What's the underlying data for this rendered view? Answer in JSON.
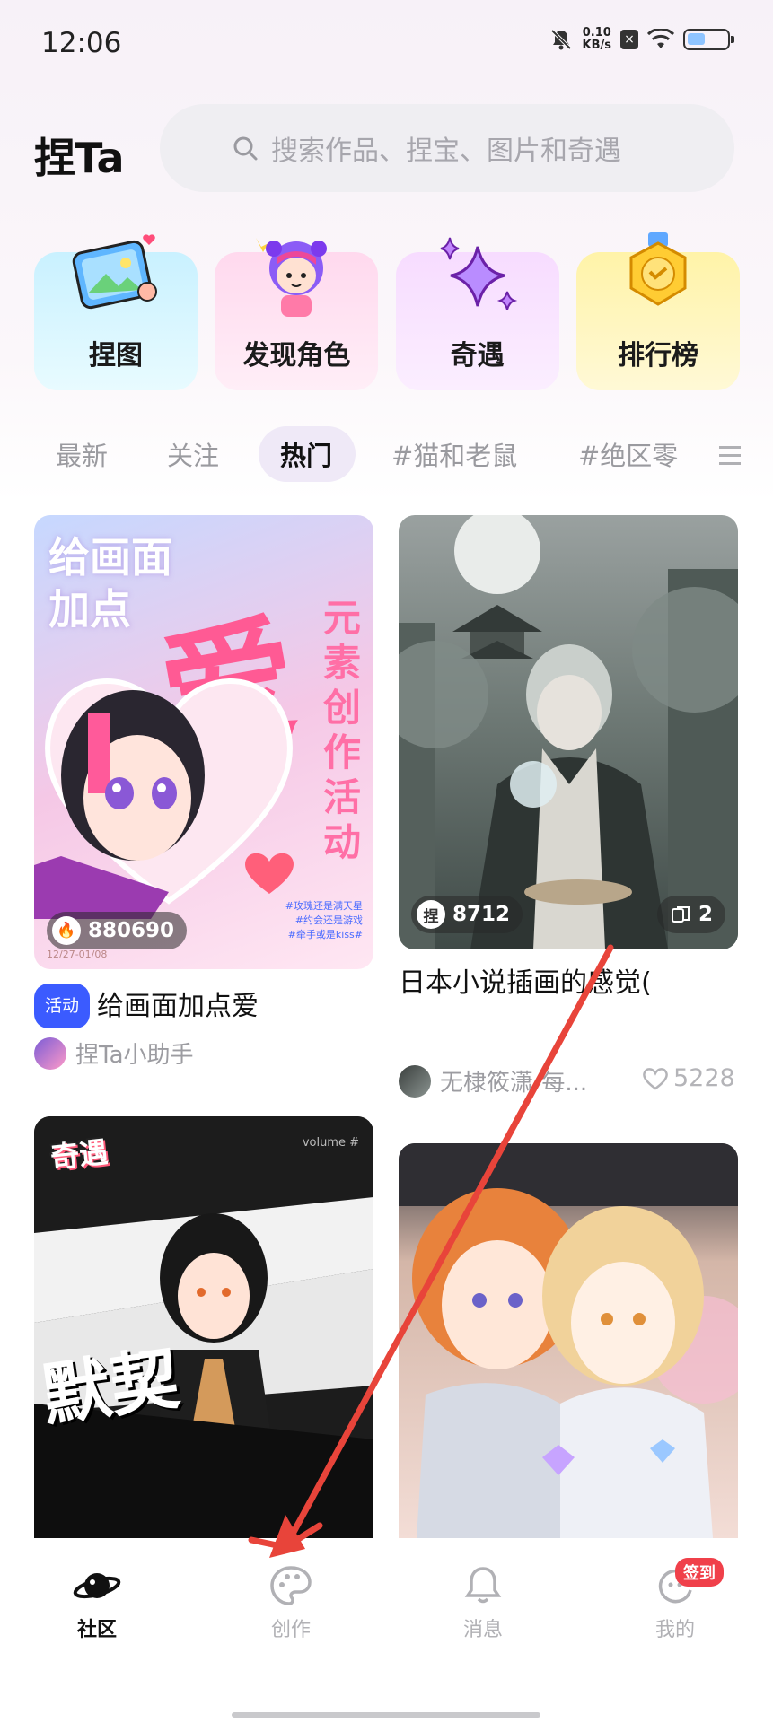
{
  "status": {
    "time": "12:06",
    "net_speed_value": "0.10",
    "net_speed_unit": "KB/s",
    "battery_level": 0.45
  },
  "header": {
    "logo": "捏Ta",
    "search_placeholder": "搜索作品、捏宝、图片和奇遇"
  },
  "quick_entries": [
    {
      "label": "捏图",
      "icon": "image-icon"
    },
    {
      "label": "发现角色",
      "icon": "character-icon"
    },
    {
      "label": "奇遇",
      "icon": "sparkle-icon"
    },
    {
      "label": "排行榜",
      "icon": "medal-icon"
    }
  ],
  "tabs": [
    {
      "label": "最新"
    },
    {
      "label": "关注"
    },
    {
      "label": "热门",
      "active": true
    },
    {
      "label": "#猫和老鼠"
    },
    {
      "label": "#绝区零"
    }
  ],
  "feed": {
    "card1": {
      "poster_title_1": "给画面",
      "poster_title_2": "加点",
      "poster_big": "爱",
      "poster_vertical": "元素创作活动",
      "poster_date": "12/27-01/08",
      "poster_small": [
        "#玫瑰还是满天星",
        "#约会还是游戏",
        "#牵手或是kiss#"
      ],
      "heat": "880690",
      "tag": "活动",
      "title": "给画面加点爱",
      "author": "捏Ta小助手"
    },
    "card2": {
      "count": "8712",
      "copies": "2",
      "title": "日本小说插画的感觉(",
      "author": "无棣筱潇-每...",
      "likes": "5228"
    },
    "card3": {
      "badge_text": "奇遇",
      "volume_text": "volume #",
      "big_text": "默契"
    },
    "card4": {}
  },
  "bottom_nav": [
    {
      "label": "社区",
      "icon": "planet-icon",
      "active": true
    },
    {
      "label": "创作",
      "icon": "palette-icon"
    },
    {
      "label": "消息",
      "icon": "bell-icon"
    },
    {
      "label": "我的",
      "icon": "profile-icon",
      "badge": "签到"
    }
  ],
  "colors": {
    "accent_blue": "#3b5bff",
    "annotation_red": "#e8443a",
    "checkin_red": "#f0404a"
  }
}
